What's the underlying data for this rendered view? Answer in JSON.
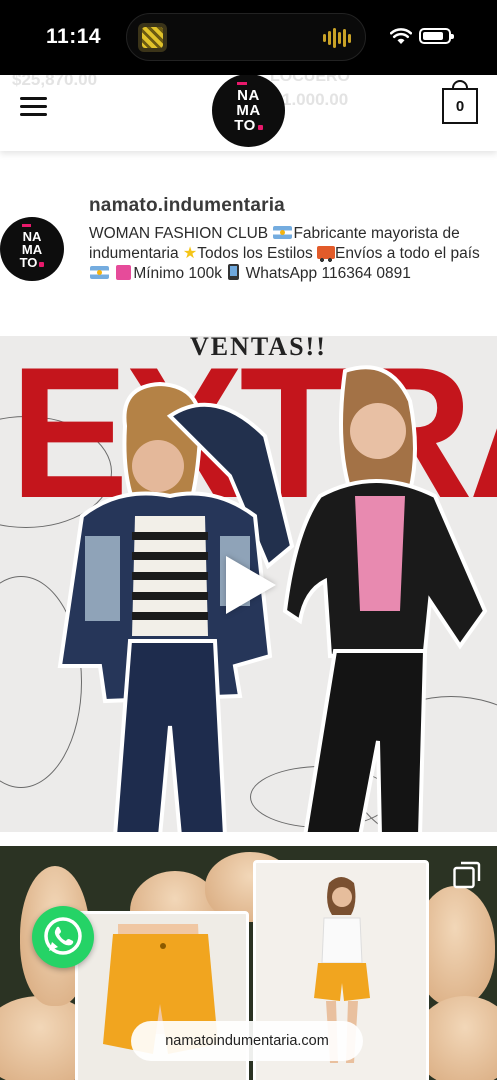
{
  "status_bar": {
    "time": "11:14"
  },
  "header": {
    "ghost_price_left": "$25,870.00",
    "ghost_label_right": "LOCUERO",
    "ghost_price_right": "1.000.00",
    "logo_line1": "NA",
    "logo_line2": "MA",
    "logo_line3": "TO",
    "cart_count": "0"
  },
  "profile": {
    "avatar_line1": "NA",
    "avatar_line2": "MA",
    "avatar_line3": "TO",
    "username": "namato.indumentaria",
    "bio_part1": "WOMAN FASHION CLUB ",
    "bio_part2": "Fabricante mayorista de indumentaria ",
    "bio_part3": "Todos los Estilos ",
    "bio_part4": "Envíos a todo el país ",
    "bio_part5": "Mínimo 100k ",
    "bio_part6": " WhatsApp 116364 0891"
  },
  "post1": {
    "subtitle": "VENTAS!!",
    "headline": "EXTRA!"
  },
  "post2": {
    "url": "namatoindumentaria.com"
  },
  "colors": {
    "brand_pink": "#e8196b",
    "banner_red": "#c4151c",
    "whatsapp_green": "#25d366"
  }
}
